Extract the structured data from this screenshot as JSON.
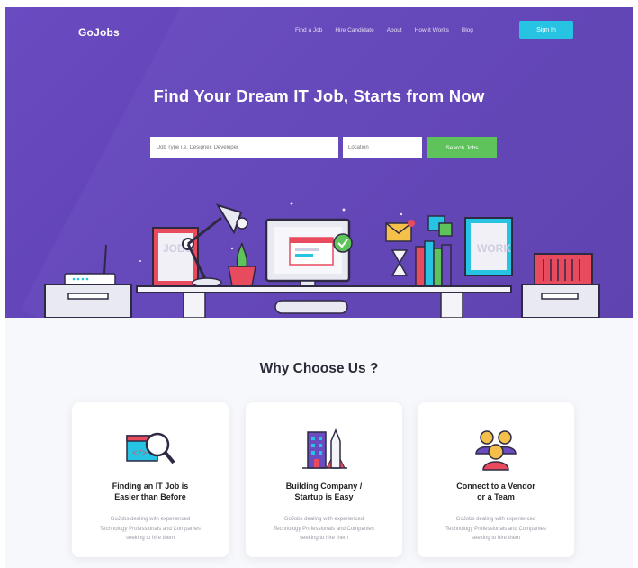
{
  "brand": {
    "logo": "GoJobs"
  },
  "nav": {
    "items": [
      "Find a Job",
      "Hire Candidate",
      "About",
      "How it Works",
      "Blog"
    ],
    "signin": "Sign In"
  },
  "hero": {
    "title": "Find Your Dream IT Job, Starts from Now",
    "job_placeholder": "Job Type i.e. Designer, Developer",
    "location_placeholder": "Location",
    "search_button": "Search Jobs",
    "illustration_text": {
      "jobs_poster": "JOBS",
      "work_poster": "WORK"
    }
  },
  "colors": {
    "hero": "#5f42b6",
    "signin": "#27c3e3",
    "search": "#5dc35a"
  },
  "why": {
    "title": "Why Choose Us ?",
    "cards": [
      {
        "icon": "magnifier-code-icon",
        "title": "Finding an IT Job is Easier than Before",
        "desc": "GoJobs dealing with experienced Technology Professionals and Companies seeking to hire them"
      },
      {
        "icon": "buildings-rocket-icon",
        "title": "Building Company / Startup is Easy",
        "desc": "GoJobs dealing with experienced Technology Professionals and Companies seeking to hire them"
      },
      {
        "icon": "team-people-icon",
        "title": "Connect to a Vendor or a Team",
        "desc": "GoJobs dealing with experienced Technology Professionals and Companies seeking to hire them"
      }
    ]
  }
}
